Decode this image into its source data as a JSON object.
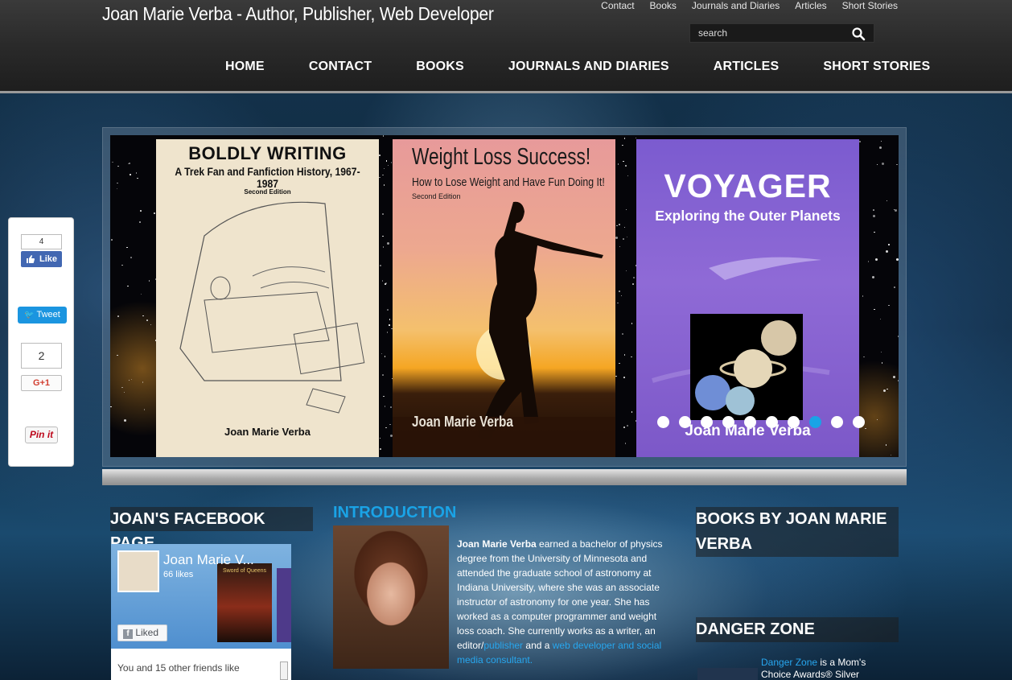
{
  "site": {
    "title": "Joan Marie Verba - Author, Publisher, Web Developer"
  },
  "topnav": [
    "Contact",
    "Books",
    "Journals and Diaries",
    "Articles",
    "Short Stories"
  ],
  "search": {
    "placeholder": "search"
  },
  "mainnav": [
    "HOME",
    "CONTACT",
    "BOOKS",
    "JOURNALS AND DIARIES",
    "ARTICLES",
    "SHORT STORIES"
  ],
  "slider": {
    "covers": [
      {
        "title": "BOLDLY WRITING",
        "subtitle": "A Trek Fan and Fanfiction History, 1967-1987",
        "edition": "Second Edition",
        "author": "Joan Marie Verba"
      },
      {
        "title": "Weight Loss Success!",
        "subtitle": "How to Lose Weight and Have Fun Doing It!",
        "edition": "Second Edition",
        "author": "Joan Marie Verba"
      },
      {
        "title": "VOYAGER",
        "subtitle": "Exploring the Outer Planets",
        "author": "Joan Marie Verba"
      }
    ],
    "dot_count": 10,
    "active_dot": 8
  },
  "share": {
    "fb_count": "4",
    "fb_like": "Like",
    "tweet": "Tweet",
    "gplus_count": "2",
    "gplus": "G+1",
    "pin": "Pin it"
  },
  "facebook": {
    "section_title": "JOAN'S FACEBOOK PAGE",
    "page_name": "Joan Marie V...",
    "likes": "66 likes",
    "book_title": "Sword of Queens",
    "liked": "Liked",
    "friends": "You and 15 other friends like"
  },
  "intro": {
    "title": "INTRODUCTION",
    "name": "Joan Marie Verba",
    "text1": " earned a bachelor of physics degree from the University of Minnesota and attended the graduate school of astronomy at Indiana University, where she was an associate instructor of astronomy for one year. She has worked as a computer programmer and weight loss coach. She currently works as a writer, an editor/",
    "link1": "publisher",
    "text2": " and a ",
    "link2": "web developer and social media consultant."
  },
  "sidebar": {
    "books_title": "BOOKS BY JOAN MARIE VERBA",
    "danger_title": "DANGER ZONE",
    "danger_link": "Danger Zone",
    "danger_text": " is a Mom's Choice Awards® Silver Recipient"
  },
  "colors": {
    "accent": "#1aa3e6",
    "header": "#2a2a2a",
    "link": "#27a6ee"
  }
}
